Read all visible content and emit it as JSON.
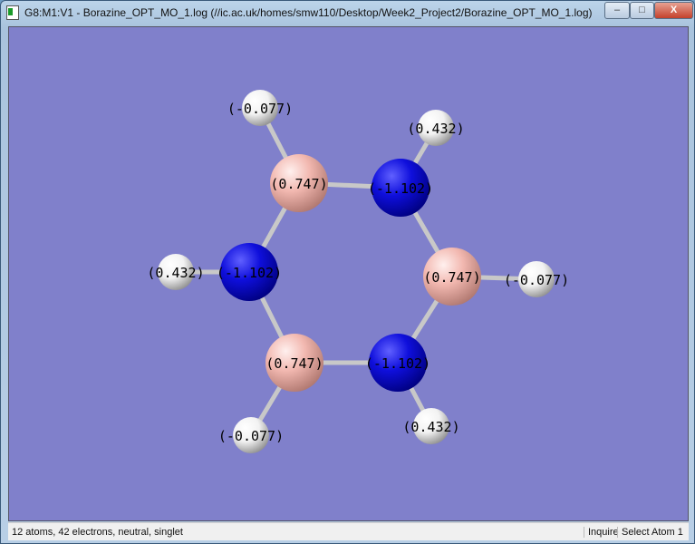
{
  "window": {
    "title": "G8:M1:V1 - Borazine_OPT_MO_1.log (//ic.ac.uk/homes/smw110/Desktop/Week2_Project2/Borazine_OPT_MO_1.log)",
    "minimize": "–",
    "maximize": "□",
    "close": "X"
  },
  "colors": {
    "background": "#8080cb",
    "boron": "#f2b8b0",
    "nitrogen": "#0f0fdc",
    "hydrogen": "#f2f2f2"
  },
  "molecule": {
    "atoms": [
      {
        "element": "B",
        "charge": "(0.747)"
      },
      {
        "element": "N",
        "charge": "(-1.102)"
      },
      {
        "element": "B",
        "charge": "(0.747)"
      },
      {
        "element": "N",
        "charge": "(-1.102)"
      },
      {
        "element": "B",
        "charge": "(0.747)"
      },
      {
        "element": "N",
        "charge": "(-1.102)"
      },
      {
        "element": "H",
        "charge": "(-0.077)"
      },
      {
        "element": "H",
        "charge": "(0.432)"
      },
      {
        "element": "H",
        "charge": "(-0.077)"
      },
      {
        "element": "H",
        "charge": "(0.432)"
      },
      {
        "element": "H",
        "charge": "(-0.077)"
      },
      {
        "element": "H",
        "charge": "(0.432)"
      }
    ]
  },
  "status": {
    "text": "12 atoms, 42 electrons, neutral, singlet",
    "mode": "Inquire",
    "selection": "Select Atom 1"
  }
}
